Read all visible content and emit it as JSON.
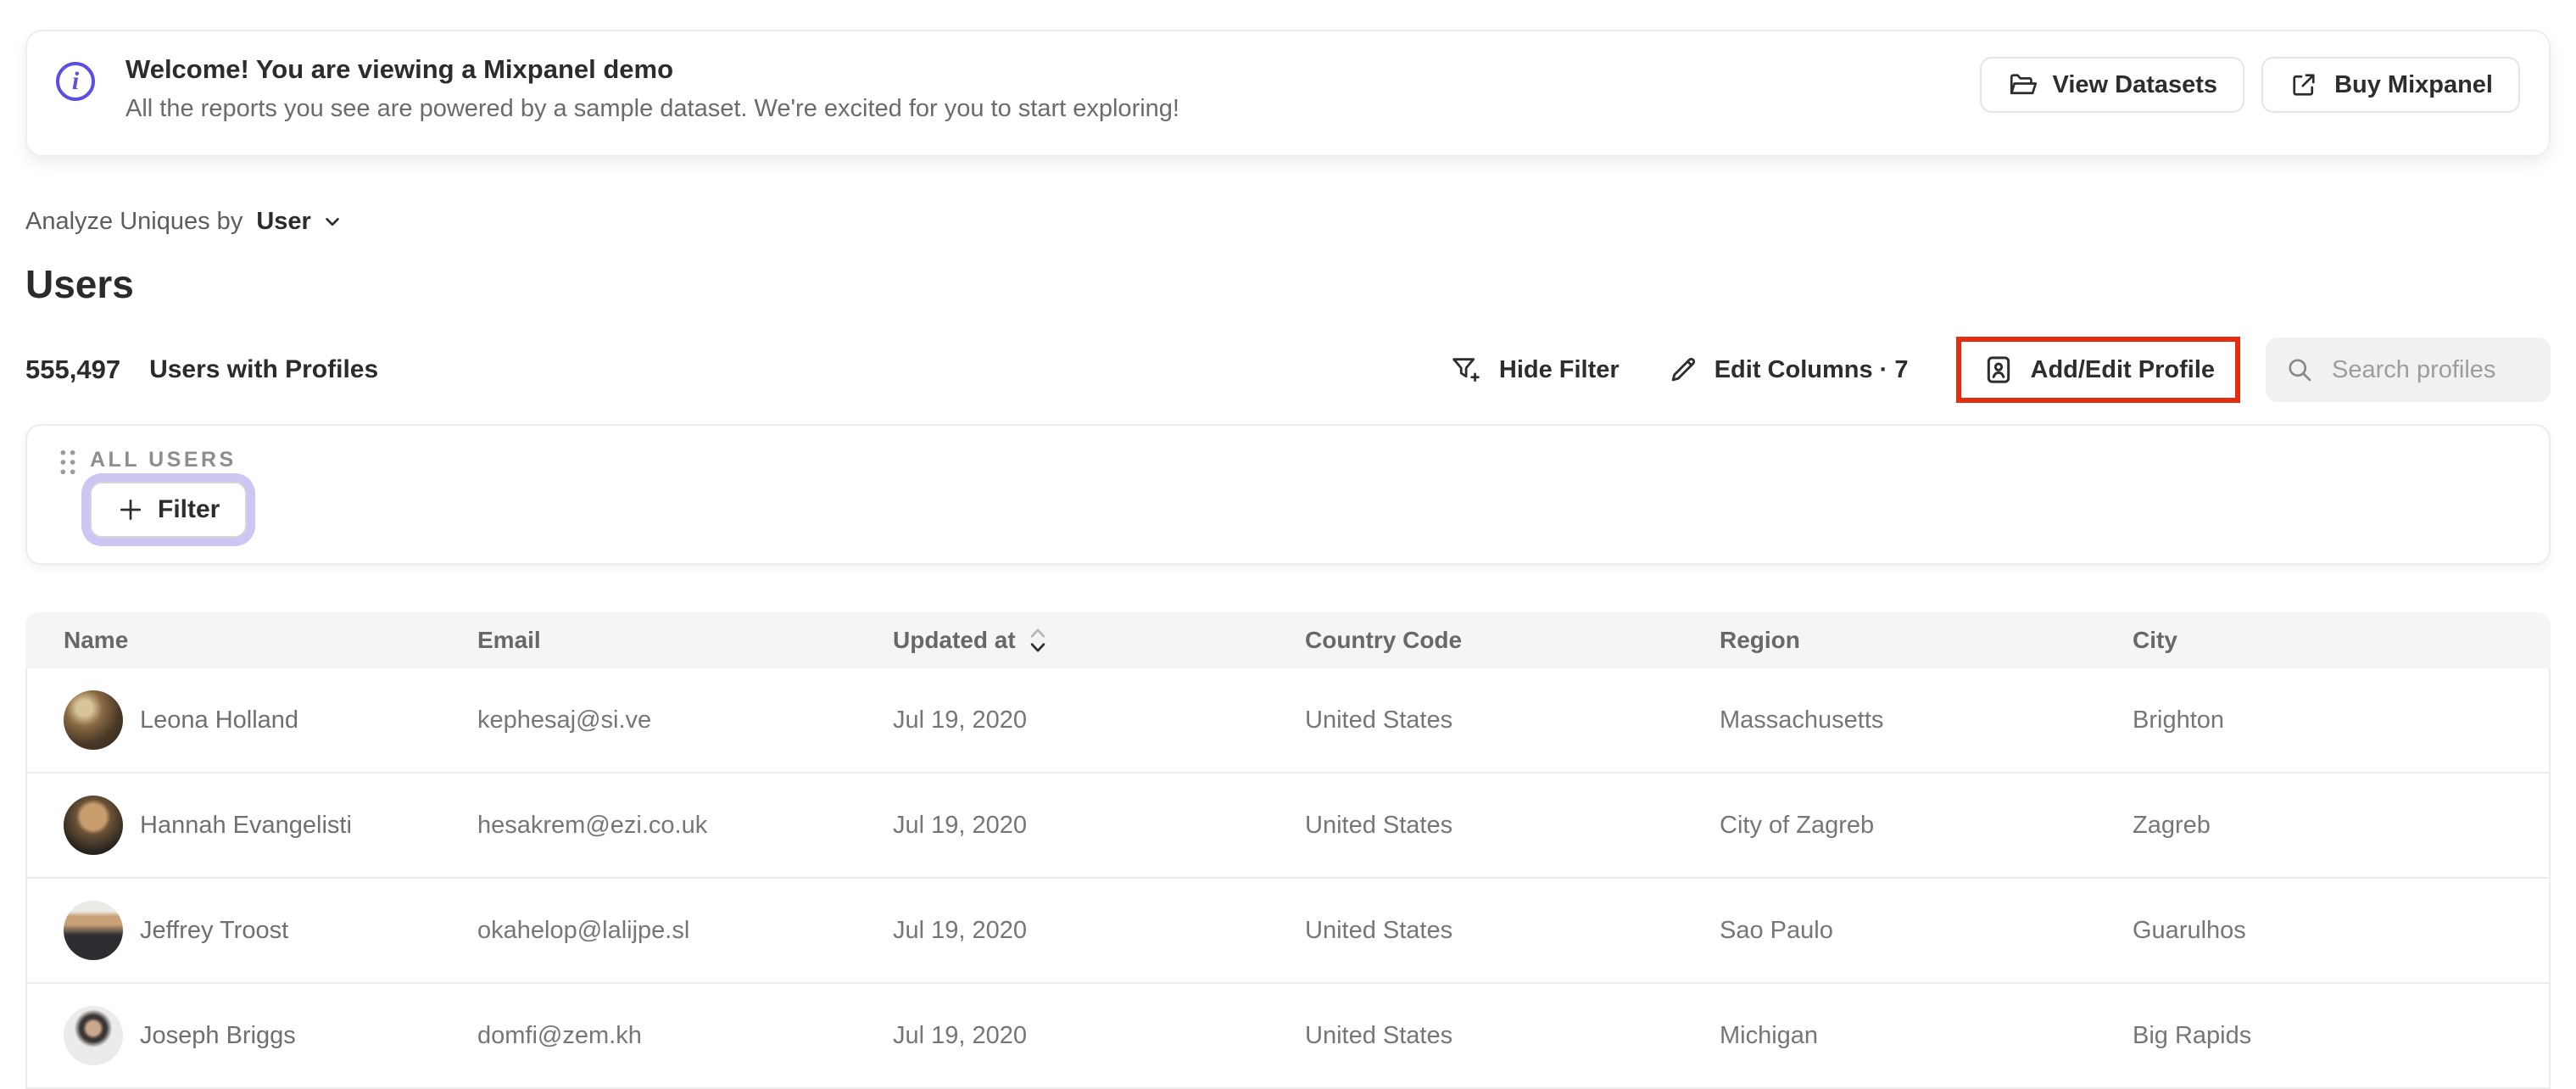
{
  "banner": {
    "title": "Welcome! You are viewing a Mixpanel demo",
    "subtitle": "All the reports you see are powered by a sample dataset. We're excited for you to start exploring!",
    "view_datasets_label": "View Datasets",
    "buy_mixpanel_label": "Buy Mixpanel"
  },
  "controls": {
    "analyze_label": "Analyze Uniques by",
    "analyze_value": "User"
  },
  "page_title": "Users",
  "stats": {
    "count": "555,497",
    "label": "Users with Profiles"
  },
  "toolbar": {
    "hide_filter_label": "Hide Filter",
    "edit_columns_label": "Edit Columns · 7",
    "add_edit_profile_label": "Add/Edit Profile",
    "search_placeholder": "Search profiles"
  },
  "filter_card": {
    "label": "ALL USERS",
    "filter_button_label": "Filter"
  },
  "table": {
    "columns": [
      "Name",
      "Email",
      "Updated at",
      "Country Code",
      "Region",
      "City"
    ],
    "rows": [
      {
        "name": "Leona Holland",
        "email": "kephesaj@si.ve",
        "updated": "Jul 19, 2020",
        "country": "United States",
        "region": "Massachusetts",
        "city": "Brighton",
        "avatar": "radial-gradient(circle at 35% 30%, #d8c49a 0 14%, #8a6a43 32%, #4a3826 62%, #2e241a 100%)"
      },
      {
        "name": "Hannah Evangelisti",
        "email": "hesakrem@ezi.co.uk",
        "updated": "Jul 19, 2020",
        "country": "United States",
        "region": "City of Zagreb",
        "city": "Zagreb",
        "avatar": "radial-gradient(circle at 50% 36%, #c99e6f 0 26%, #6b5236 36%, #26221e 74%)"
      },
      {
        "name": "Jeffrey Troost",
        "email": "okahelop@lalijpe.sl",
        "updated": "Jul 19, 2020",
        "country": "United States",
        "region": "Sao Paulo",
        "city": "Guarulhos",
        "avatar": "linear-gradient(180deg, #eceae7 0 18%, #caa277 26% 40%, #2d2d31 58% 100%)"
      },
      {
        "name": "Joseph Briggs",
        "email": "domfi@zem.kh",
        "updated": "Jul 19, 2020",
        "country": "United States",
        "region": "Michigan",
        "city": "Big Rapids",
        "avatar": "radial-gradient(circle at 50% 38%, #caa88d 0 14%, #3c3733 22% 28%, #ebebed 40%)"
      }
    ]
  },
  "colors": {
    "accent_purple": "#5b4ee4",
    "highlight_red": "#e32d10",
    "focus_ring_lavender": "#cbc7f2"
  }
}
